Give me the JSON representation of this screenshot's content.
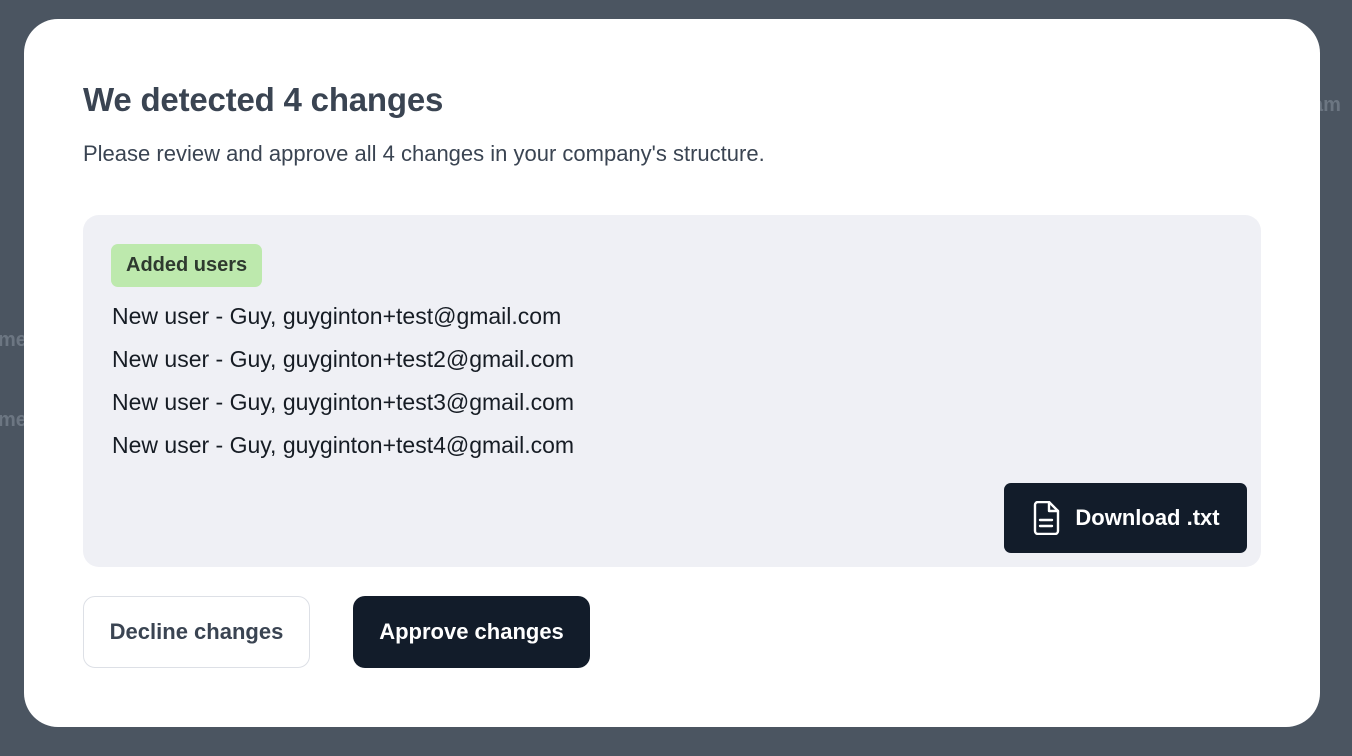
{
  "background": {
    "fragments": [
      "am",
      "me",
      "me"
    ]
  },
  "modal": {
    "title": "We detected 4 changes",
    "subtitle": "Please review and approve all 4 changes in your company's structure."
  },
  "changes": {
    "badge": "Added users",
    "badge_color": "#bde9ad",
    "items": [
      "New user - Guy, guyginton+test@gmail.com",
      "New user - Guy, guyginton+test2@gmail.com",
      "New user - Guy, guyginton+test3@gmail.com",
      "New user - Guy, guyginton+test4@gmail.com"
    ],
    "download_label": "Download .txt",
    "download_icon": "file-text-icon"
  },
  "actions": {
    "decline_label": "Decline changes",
    "approve_label": "Approve changes",
    "primary_color": "#121c2a"
  }
}
